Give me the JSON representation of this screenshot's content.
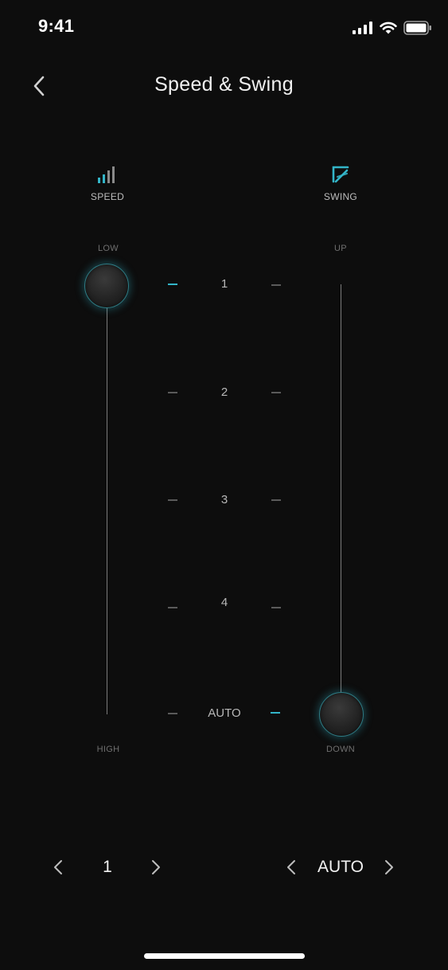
{
  "status_bar": {
    "time": "9:41"
  },
  "header": {
    "title": "Speed & Swing"
  },
  "speed": {
    "label": "SPEED",
    "top_label": "LOW",
    "bottom_label": "HIGH",
    "value": "1",
    "selected_level": "1"
  },
  "swing": {
    "label": "SWING",
    "top_label": "UP",
    "bottom_label": "DOWN",
    "value": "AUTO",
    "selected_level": "AUTO"
  },
  "levels": [
    "1",
    "2",
    "3",
    "4",
    "AUTO"
  ],
  "colors": {
    "accent": "#33b5c8",
    "background": "#0d0d0d"
  },
  "icons": {
    "back": "chevron-left-icon",
    "speed": "signal-bars-icon",
    "swing": "swing-fan-icon"
  }
}
